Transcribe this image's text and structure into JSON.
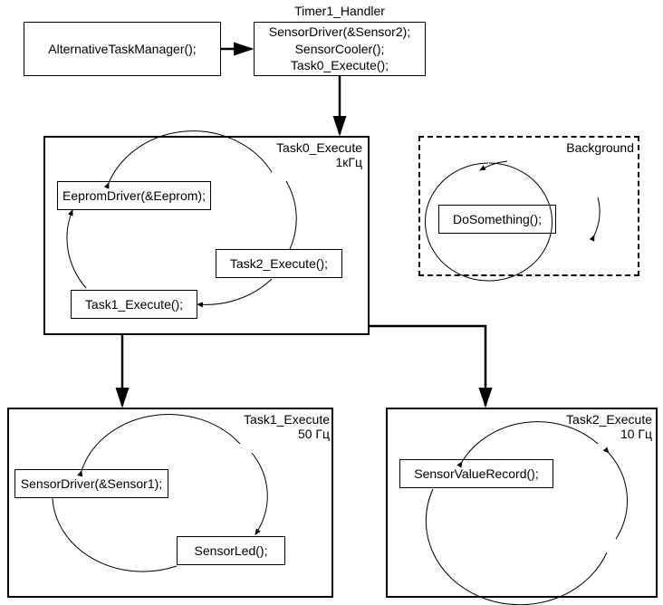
{
  "handler": {
    "title": "Timer1_Handler",
    "alt_task_manager": "AlternativeTaskManager();",
    "body_line1": "SensorDriver(&Sensor2);",
    "body_line2": "SensorCooler();",
    "body_line3": "Task0_Execute();"
  },
  "task0": {
    "title_line1": "Task0_Execute",
    "title_line2": "1кГц",
    "eeprom": "EepromDriver(&Eeprom);",
    "t1": "Task1_Execute();",
    "t2": "Task2_Execute();"
  },
  "background": {
    "title": "Background",
    "doSomething": "DoSomething();"
  },
  "task1": {
    "title_line1": "Task1_Execute",
    "title_line2": "50 Гц",
    "sensorDriver": "SensorDriver(&Sensor1);",
    "sensorLed": "SensorLed();"
  },
  "task2": {
    "title_line1": "Task2_Execute",
    "title_line2": "10 Гц",
    "record": "SensorValueRecord();"
  }
}
